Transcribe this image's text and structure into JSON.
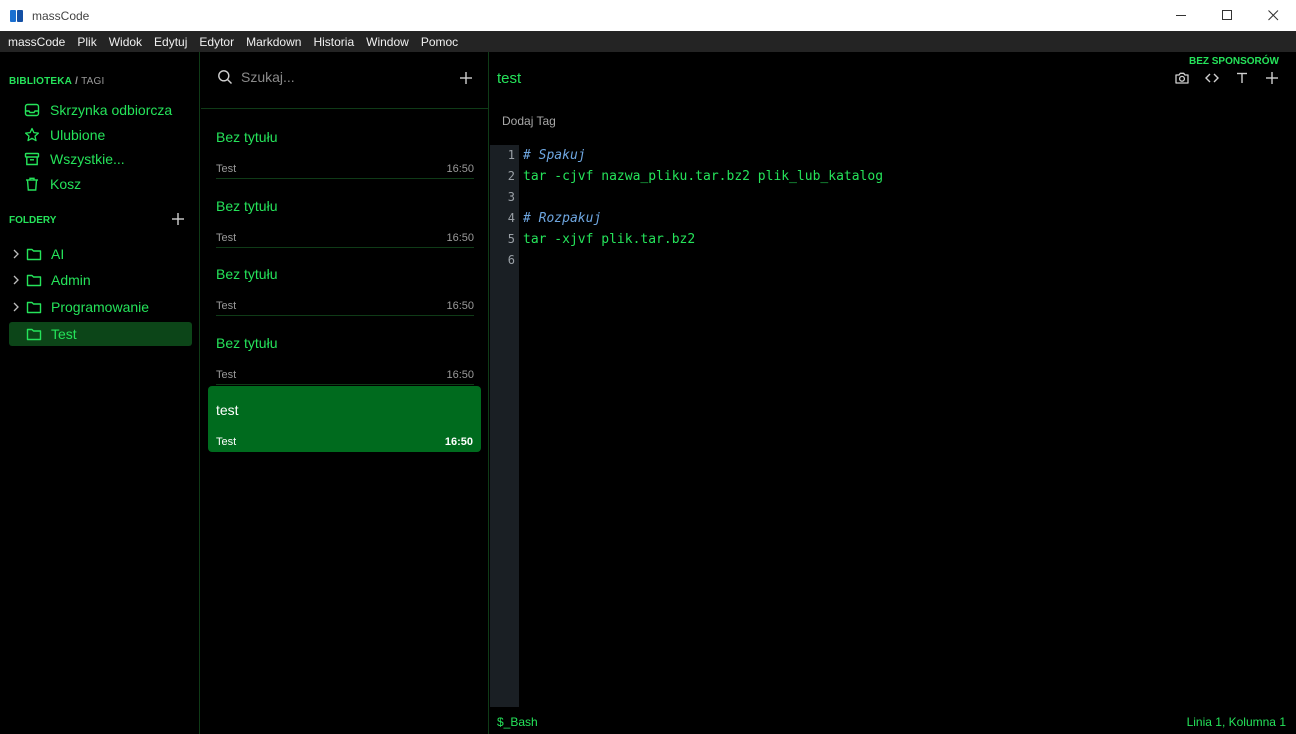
{
  "window": {
    "title": "massCode"
  },
  "menu": [
    "massCode",
    "Plik",
    "Widok",
    "Edytuj",
    "Edytor",
    "Markdown",
    "Historia",
    "Window",
    "Pomoc"
  ],
  "sidebar": {
    "library_label": "BIBLIOTEKA",
    "tags_label": "TAGI",
    "items": [
      {
        "label": "Skrzynka odbiorcza",
        "icon": "inbox-icon"
      },
      {
        "label": "Ulubione",
        "icon": "star-icon"
      },
      {
        "label": "Wszystkie...",
        "icon": "archive-icon"
      },
      {
        "label": "Kosz",
        "icon": "trash-icon"
      }
    ],
    "folders_label": "FOLDERY",
    "folders": [
      {
        "label": "AI",
        "expandable": true
      },
      {
        "label": "Admin",
        "expandable": true
      },
      {
        "label": "Programowanie",
        "expandable": true
      },
      {
        "label": "Test",
        "expandable": false,
        "active": true
      }
    ]
  },
  "list": {
    "search_placeholder": "Szukaj...",
    "snippets": [
      {
        "name": "Bez tytułu",
        "folder": "Test",
        "time": "16:50"
      },
      {
        "name": "Bez tytułu",
        "folder": "Test",
        "time": "16:50"
      },
      {
        "name": "Bez tytułu",
        "folder": "Test",
        "time": "16:50"
      },
      {
        "name": "Bez tytułu",
        "folder": "Test",
        "time": "16:50"
      },
      {
        "name": "test",
        "folder": "Test",
        "time": "16:50",
        "active": true
      }
    ]
  },
  "editor": {
    "sponsor": "BEZ SPONSORÓW",
    "title": "test",
    "add_tag": "Dodaj Tag",
    "line_numbers": [
      "1",
      "2",
      "3",
      "4",
      "5",
      "6"
    ],
    "lines": [
      {
        "text": "# Spakuj",
        "kind": "comment"
      },
      {
        "text": "tar -cjvf nazwa_pliku.tar.bz2 plik_lub_katalog",
        "kind": "code"
      },
      {
        "text": "",
        "kind": "code"
      },
      {
        "text": "# Rozpakuj",
        "kind": "comment"
      },
      {
        "text": "tar -xjvf plik.tar.bz2",
        "kind": "code"
      },
      {
        "text": "",
        "kind": "code"
      }
    ],
    "language": "$_Bash",
    "cursor": "Linia 1, Kolumna 1"
  },
  "colors": {
    "accent": "#25e35a",
    "active_bg": "#006b1e",
    "folder_active_bg": "#0c4518"
  }
}
